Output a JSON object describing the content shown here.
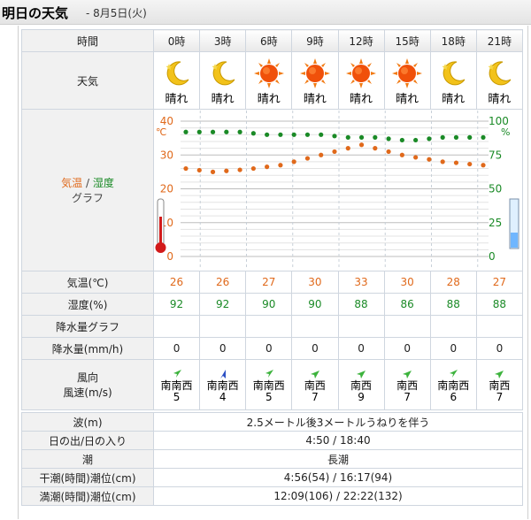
{
  "header": {
    "title": "明日の天気",
    "date": "- 8月5日(火)"
  },
  "labels": {
    "time": "時間",
    "weather": "天気",
    "graph_temp": "気温",
    "graph_sep": " / ",
    "graph_hum": "湿度",
    "graph_word": "グラフ",
    "temp_row": "気温(℃)",
    "hum_row": "湿度(%)",
    "precip_graph_row": "降水量グラフ",
    "precip_row": "降水量(mm/h)",
    "wind_row_1": "風向",
    "wind_row_2": "風速(m/s)"
  },
  "slots": [
    {
      "time": "0時",
      "weather": "晴れ",
      "icon": "moon-icon",
      "temp": "26",
      "hum": "92",
      "precip": "0",
      "wind_dir": "南南西",
      "wind_speed": "5"
    },
    {
      "time": "3時",
      "weather": "晴れ",
      "icon": "moon-icon",
      "temp": "26",
      "hum": "92",
      "precip": "0",
      "wind_dir": "南南西",
      "wind_speed": "4"
    },
    {
      "time": "6時",
      "weather": "晴れ",
      "icon": "sun-icon",
      "temp": "27",
      "hum": "90",
      "precip": "0",
      "wind_dir": "南南西",
      "wind_speed": "5"
    },
    {
      "time": "9時",
      "weather": "晴れ",
      "icon": "sun-icon",
      "temp": "30",
      "hum": "90",
      "precip": "0",
      "wind_dir": "南西",
      "wind_speed": "7"
    },
    {
      "time": "12時",
      "weather": "晴れ",
      "icon": "sun-icon",
      "temp": "33",
      "hum": "88",
      "precip": "0",
      "wind_dir": "南西",
      "wind_speed": "9"
    },
    {
      "time": "15時",
      "weather": "晴れ",
      "icon": "sun-icon",
      "temp": "30",
      "hum": "86",
      "precip": "0",
      "wind_dir": "南西",
      "wind_speed": "7"
    },
    {
      "time": "18時",
      "weather": "晴れ",
      "icon": "moon-icon",
      "temp": "28",
      "hum": "88",
      "precip": "0",
      "wind_dir": "南南西",
      "wind_speed": "6"
    },
    {
      "time": "21時",
      "weather": "晴れ",
      "icon": "moon-icon",
      "temp": "27",
      "hum": "88",
      "precip": "0",
      "wind_dir": "南西",
      "wind_speed": "7"
    }
  ],
  "chart_data": {
    "type": "line",
    "x": [
      "0時",
      "",
      "",
      "3時",
      "",
      "",
      "6時",
      "",
      "",
      "9時",
      "",
      "",
      "12時",
      "",
      "",
      "15時",
      "",
      "",
      "18時",
      "",
      "",
      "21時",
      ""
    ],
    "series": [
      {
        "name": "気温",
        "axis": "left",
        "color": "#e0691b",
        "values": [
          26,
          25.5,
          25,
          25.3,
          25.6,
          26,
          26.5,
          27,
          28,
          29,
          30,
          31,
          32,
          33,
          32,
          31,
          30,
          29.3,
          28.7,
          28,
          27.7,
          27.3,
          27
        ]
      },
      {
        "name": "湿度",
        "axis": "right",
        "color": "#1a8a26",
        "values": [
          92,
          92,
          92,
          92,
          92,
          91,
          90,
          90,
          90,
          90,
          90,
          89,
          88,
          88,
          88,
          87,
          86,
          86,
          87,
          88,
          88,
          88,
          88
        ]
      }
    ],
    "left_axis": {
      "unit": "℃",
      "ticks": [
        "40",
        "30",
        "20",
        "10",
        "0"
      ],
      "min": 0,
      "max": 40
    },
    "right_axis": {
      "unit": "%",
      "ticks": [
        "100",
        "75",
        "50",
        "25",
        "0"
      ],
      "min": 0,
      "max": 100
    },
    "grid": true
  },
  "info": [
    {
      "label": "波(m)",
      "value": "2.5メートル後3メートルうねりを伴う"
    },
    {
      "label": "日の出/日の入り",
      "value": "4:50 / 18:40"
    },
    {
      "label": "潮",
      "value": "長潮"
    },
    {
      "label": "干潮(時間)潮位(cm)",
      "value": "4:56(54) / 16:17(94)"
    },
    {
      "label": "満潮(時間)潮位(cm)",
      "value": "12:09(106) / 22:22(132)"
    }
  ],
  "colors": {
    "temp": "#e0691b",
    "humidity": "#1a8a26",
    "sun": "#f0500a",
    "moon": "#f2c21a",
    "wind_arrow": "#3db33d",
    "wind_arrow_slot2": "#2b4fc4"
  }
}
